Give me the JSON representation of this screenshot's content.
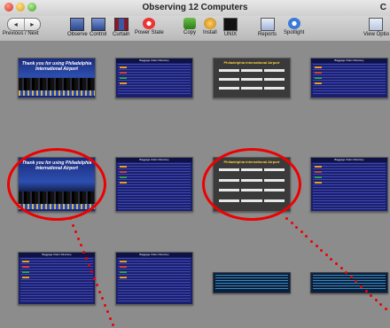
{
  "window": {
    "title": "Observing 12 Computers",
    "title_right": "C"
  },
  "toolbar": {
    "nav": {
      "prev": "◂",
      "next": "▸",
      "label": "Previous / Next"
    },
    "items": [
      {
        "label": "Observe",
        "icon": "observe-icon"
      },
      {
        "label": "Control",
        "icon": "control-icon"
      },
      {
        "label": "Curtain",
        "icon": "curtain-icon"
      },
      {
        "label": "Power State",
        "icon": "power-icon"
      },
      {
        "label": "Copy",
        "icon": "copy-icon"
      },
      {
        "label": "Install",
        "icon": "install-icon"
      },
      {
        "label": "UNIX",
        "icon": "unix-icon"
      },
      {
        "label": "Reports",
        "icon": "reports-icon"
      },
      {
        "label": "Spotlight",
        "icon": "spotlight-icon"
      },
      {
        "label": "View Optio",
        "icon": "view-options-icon"
      }
    ]
  },
  "screens": {
    "welcome_text": "Thank you for using Philadelphia International Airport",
    "baggage_title": "Baggage Claim Directory",
    "airport_title": "Philadelphia International Airport",
    "airport_subtitle": "is served by:"
  },
  "colors": {
    "annotation": "#e00000",
    "content_bg": "#8c8c8c"
  }
}
